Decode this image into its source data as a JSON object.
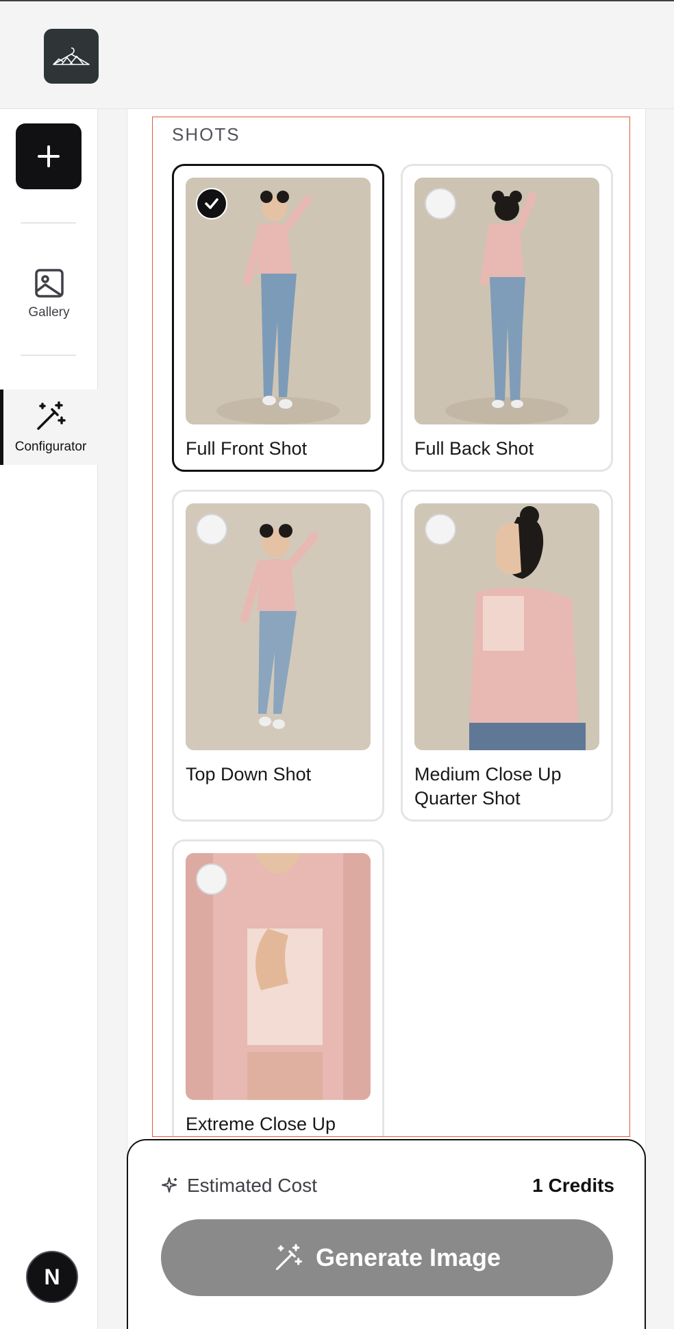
{
  "app": {
    "logo_icon": "hanger-logo-icon",
    "new_button_icon": "plus-icon",
    "user_avatar_letter": "N"
  },
  "sidebar": {
    "items": [
      {
        "label": "Gallery",
        "icon": "image-icon",
        "active": false
      },
      {
        "label": "Configurator",
        "icon": "magic-wand-icon",
        "active": true
      }
    ]
  },
  "shots": {
    "title": "SHOTS",
    "items": [
      {
        "label": "Full Front Shot",
        "selected": true
      },
      {
        "label": "Full Back Shot",
        "selected": false
      },
      {
        "label": "Top Down Shot",
        "selected": false
      },
      {
        "label": "Medium Close Up Quarter Shot",
        "selected": false
      },
      {
        "label": "Extreme Close Up",
        "selected": false
      }
    ]
  },
  "footer": {
    "cost_label": "Estimated Cost",
    "cost_value": "1 Credits",
    "cost_icon": "sparkle-icon",
    "generate_label": "Generate Image",
    "generate_icon": "magic-wand-icon"
  },
  "colors": {
    "accent_dark": "#111113",
    "panel_outline": "#e05a3a",
    "button_disabled": "#8a8a8a"
  }
}
